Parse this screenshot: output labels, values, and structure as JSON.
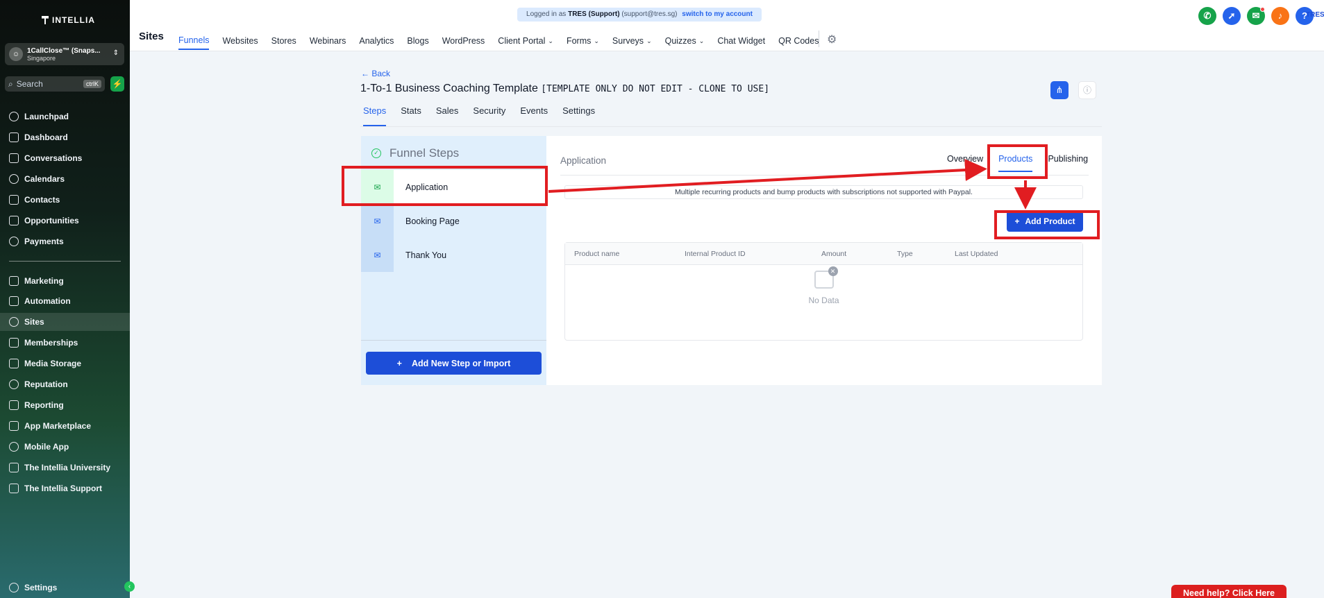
{
  "brand": {
    "name": "INTELLIA"
  },
  "account": {
    "name": "1CallClose™ (Snaps...",
    "location": "Singapore",
    "avatar_icon": "user-icon"
  },
  "search": {
    "placeholder": "Search",
    "shortcut": "ctrlK"
  },
  "sidebar": {
    "items": [
      {
        "label": "Launchpad",
        "icon": "rocket-icon"
      },
      {
        "label": "Dashboard",
        "icon": "grid-icon"
      },
      {
        "label": "Conversations",
        "icon": "chat-icon"
      },
      {
        "label": "Calendars",
        "icon": "calendar-icon"
      },
      {
        "label": "Contacts",
        "icon": "contacts-icon"
      },
      {
        "label": "Opportunities",
        "icon": "network-icon"
      },
      {
        "label": "Payments",
        "icon": "receipt-icon"
      },
      {
        "label": "Marketing",
        "icon": "send-icon"
      },
      {
        "label": "Automation",
        "icon": "automation-icon"
      },
      {
        "label": "Sites",
        "icon": "globe-icon",
        "active": true
      },
      {
        "label": "Memberships",
        "icon": "badge-icon"
      },
      {
        "label": "Media Storage",
        "icon": "image-icon"
      },
      {
        "label": "Reputation",
        "icon": "star-icon"
      },
      {
        "label": "Reporting",
        "icon": "trend-icon"
      },
      {
        "label": "App Marketplace",
        "icon": "apps-icon"
      },
      {
        "label": "Mobile App",
        "icon": "mobile-icon"
      },
      {
        "label": "The Intellia University",
        "icon": "graduation-icon"
      },
      {
        "label": "The Intellia Support",
        "icon": "headset-icon"
      }
    ],
    "settings_label": "Settings"
  },
  "topbar": {
    "login_prefix": "Logged in as",
    "login_user": "TRES (Support)",
    "login_email": "(support@tres.sg)",
    "switch_label": "switch to my account",
    "page_heading": "Sites",
    "nav": [
      {
        "label": "Funnels",
        "active": true,
        "dropdown": false
      },
      {
        "label": "Websites",
        "dropdown": false
      },
      {
        "label": "Stores",
        "dropdown": false
      },
      {
        "label": "Webinars",
        "dropdown": false
      },
      {
        "label": "Analytics",
        "dropdown": false
      },
      {
        "label": "Blogs",
        "dropdown": false
      },
      {
        "label": "WordPress",
        "dropdown": false
      },
      {
        "label": "Client Portal",
        "dropdown": true
      },
      {
        "label": "Forms",
        "dropdown": true
      },
      {
        "label": "Surveys",
        "dropdown": true
      },
      {
        "label": "Quizzes",
        "dropdown": true
      },
      {
        "label": "Chat Widget",
        "dropdown": false
      },
      {
        "label": "QR Codes",
        "dropdown": false
      }
    ],
    "user_initials": "TRES",
    "actions": [
      {
        "icon": "phone-icon",
        "color": "#16a34a"
      },
      {
        "icon": "rocket-icon",
        "color": "#2563eb"
      },
      {
        "icon": "megaphone-icon",
        "color": "#16a34a"
      },
      {
        "icon": "bell-icon",
        "color": "#f97316"
      },
      {
        "icon": "help-icon",
        "color": "#2563eb"
      }
    ]
  },
  "funnel": {
    "back_label": "Back",
    "title": "1-To-1 Business Coaching Template",
    "title_note": "[TEMPLATE ONLY DO NOT EDIT - CLONE TO USE]",
    "tabs": [
      "Steps",
      "Stats",
      "Sales",
      "Security",
      "Events",
      "Settings"
    ],
    "steps_heading": "Funnel Steps",
    "steps": [
      "Application",
      "Booking Page",
      "Thank You"
    ],
    "add_step_label": "Add New Step or Import"
  },
  "step_detail": {
    "title": "Application",
    "tabs": [
      "Overview",
      "Products",
      "Publishing"
    ],
    "active_tab": "Products",
    "notice": "Multiple recurring products and bump products with subscriptions not supported with Paypal.",
    "add_product_label": "Add Product",
    "columns": [
      "Product name",
      "Internal Product ID",
      "Amount",
      "Type",
      "Last Updated"
    ],
    "empty_text": "No Data"
  },
  "help_button": "Need help? Click Here",
  "colors": {
    "accent": "#2563eb",
    "annotation": "#e11d21"
  }
}
